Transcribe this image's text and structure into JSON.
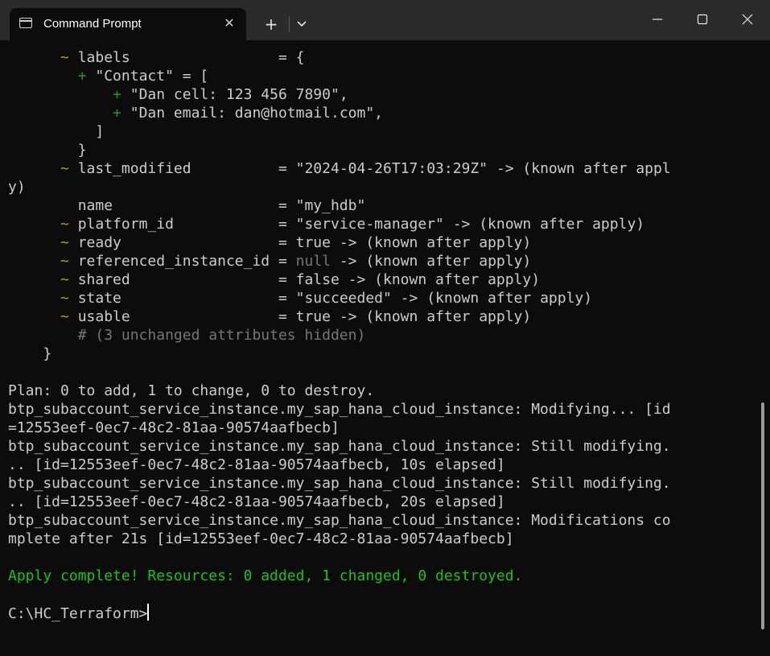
{
  "window": {
    "tab_title": "Command Prompt",
    "tab_icon": "terminal-icon",
    "new_tab_label": "+",
    "close_tab_label": "✕"
  },
  "terminal": {
    "lines": [
      {
        "segs": [
          {
            "t": "      "
          },
          {
            "t": "~",
            "c": "y"
          },
          {
            "t": " labels                 = {"
          }
        ]
      },
      {
        "segs": [
          {
            "t": "        "
          },
          {
            "t": "+",
            "c": "g"
          },
          {
            "t": " \"Contact\" = ["
          }
        ]
      },
      {
        "segs": [
          {
            "t": "            "
          },
          {
            "t": "+",
            "c": "g"
          },
          {
            "t": " \"Dan cell: 123 456 7890\","
          }
        ]
      },
      {
        "segs": [
          {
            "t": "            "
          },
          {
            "t": "+",
            "c": "g"
          },
          {
            "t": " \"Dan email: dan@hotmail.com\","
          }
        ]
      },
      {
        "segs": [
          {
            "t": "          ]"
          }
        ]
      },
      {
        "segs": [
          {
            "t": "        }"
          }
        ]
      },
      {
        "segs": [
          {
            "t": "      "
          },
          {
            "t": "~",
            "c": "y"
          },
          {
            "t": " last_modified          = \"2024-04-26T17:03:29Z\" -> (known after appl"
          }
        ]
      },
      {
        "segs": [
          {
            "t": "y)"
          }
        ]
      },
      {
        "segs": [
          {
            "t": "        name                   = \"my_hdb\""
          }
        ]
      },
      {
        "segs": [
          {
            "t": "      "
          },
          {
            "t": "~",
            "c": "y"
          },
          {
            "t": " platform_id            = \"service-manager\" -> (known after apply)"
          }
        ]
      },
      {
        "segs": [
          {
            "t": "      "
          },
          {
            "t": "~",
            "c": "y"
          },
          {
            "t": " ready                  = true -> (known after apply)"
          }
        ]
      },
      {
        "segs": [
          {
            "t": "      "
          },
          {
            "t": "~",
            "c": "y"
          },
          {
            "t": " referenced_instance_id = "
          },
          {
            "t": "null",
            "c": "dim"
          },
          {
            "t": " -> (known after apply)"
          }
        ]
      },
      {
        "segs": [
          {
            "t": "      "
          },
          {
            "t": "~",
            "c": "y"
          },
          {
            "t": " shared                 = false -> (known after apply)"
          }
        ]
      },
      {
        "segs": [
          {
            "t": "      "
          },
          {
            "t": "~",
            "c": "y"
          },
          {
            "t": " state                  = \"succeeded\" -> (known after apply)"
          }
        ]
      },
      {
        "segs": [
          {
            "t": "      "
          },
          {
            "t": "~",
            "c": "y"
          },
          {
            "t": " usable                 = true -> (known after apply)"
          }
        ]
      },
      {
        "segs": [
          {
            "t": "        "
          },
          {
            "t": "# (3 unchanged attributes hidden)",
            "c": "dim"
          }
        ]
      },
      {
        "segs": [
          {
            "t": "    }"
          }
        ]
      },
      {
        "segs": [
          {
            "t": ""
          }
        ]
      },
      {
        "segs": [
          {
            "t": "Plan: 0 to add, 1 to change, 0 to destroy."
          }
        ]
      },
      {
        "segs": [
          {
            "t": "btp_subaccount_service_instance.my_sap_hana_cloud_instance: Modifying... [id"
          }
        ]
      },
      {
        "segs": [
          {
            "t": "=12553eef-0ec7-48c2-81aa-90574aafbecb]"
          }
        ]
      },
      {
        "segs": [
          {
            "t": "btp_subaccount_service_instance.my_sap_hana_cloud_instance: Still modifying."
          }
        ]
      },
      {
        "segs": [
          {
            "t": ".. [id=12553eef-0ec7-48c2-81aa-90574aafbecb, 10s elapsed]"
          }
        ]
      },
      {
        "segs": [
          {
            "t": "btp_subaccount_service_instance.my_sap_hana_cloud_instance: Still modifying."
          }
        ]
      },
      {
        "segs": [
          {
            "t": ".. [id=12553eef-0ec7-48c2-81aa-90574aafbecb, 20s elapsed]"
          }
        ]
      },
      {
        "segs": [
          {
            "t": "btp_subaccount_service_instance.my_sap_hana_cloud_instance: Modifications co"
          }
        ]
      },
      {
        "segs": [
          {
            "t": "mplete after 21s [id=12553eef-0ec7-48c2-81aa-90574aafbecb]"
          }
        ]
      },
      {
        "segs": [
          {
            "t": ""
          }
        ]
      },
      {
        "segs": [
          {
            "t": "Apply complete! Resources: 0 added, 1 changed, 0 destroyed.",
            "c": "ok"
          }
        ]
      },
      {
        "segs": [
          {
            "t": ""
          }
        ]
      }
    ],
    "prompt": "C:\\HC_Terraform>"
  },
  "colors": {
    "background": "#0c0c0c",
    "text": "#cccccc",
    "modified_marker": "#c19c00",
    "added_marker": "#13a10e",
    "success": "#16c60c",
    "dim": "#767676"
  }
}
